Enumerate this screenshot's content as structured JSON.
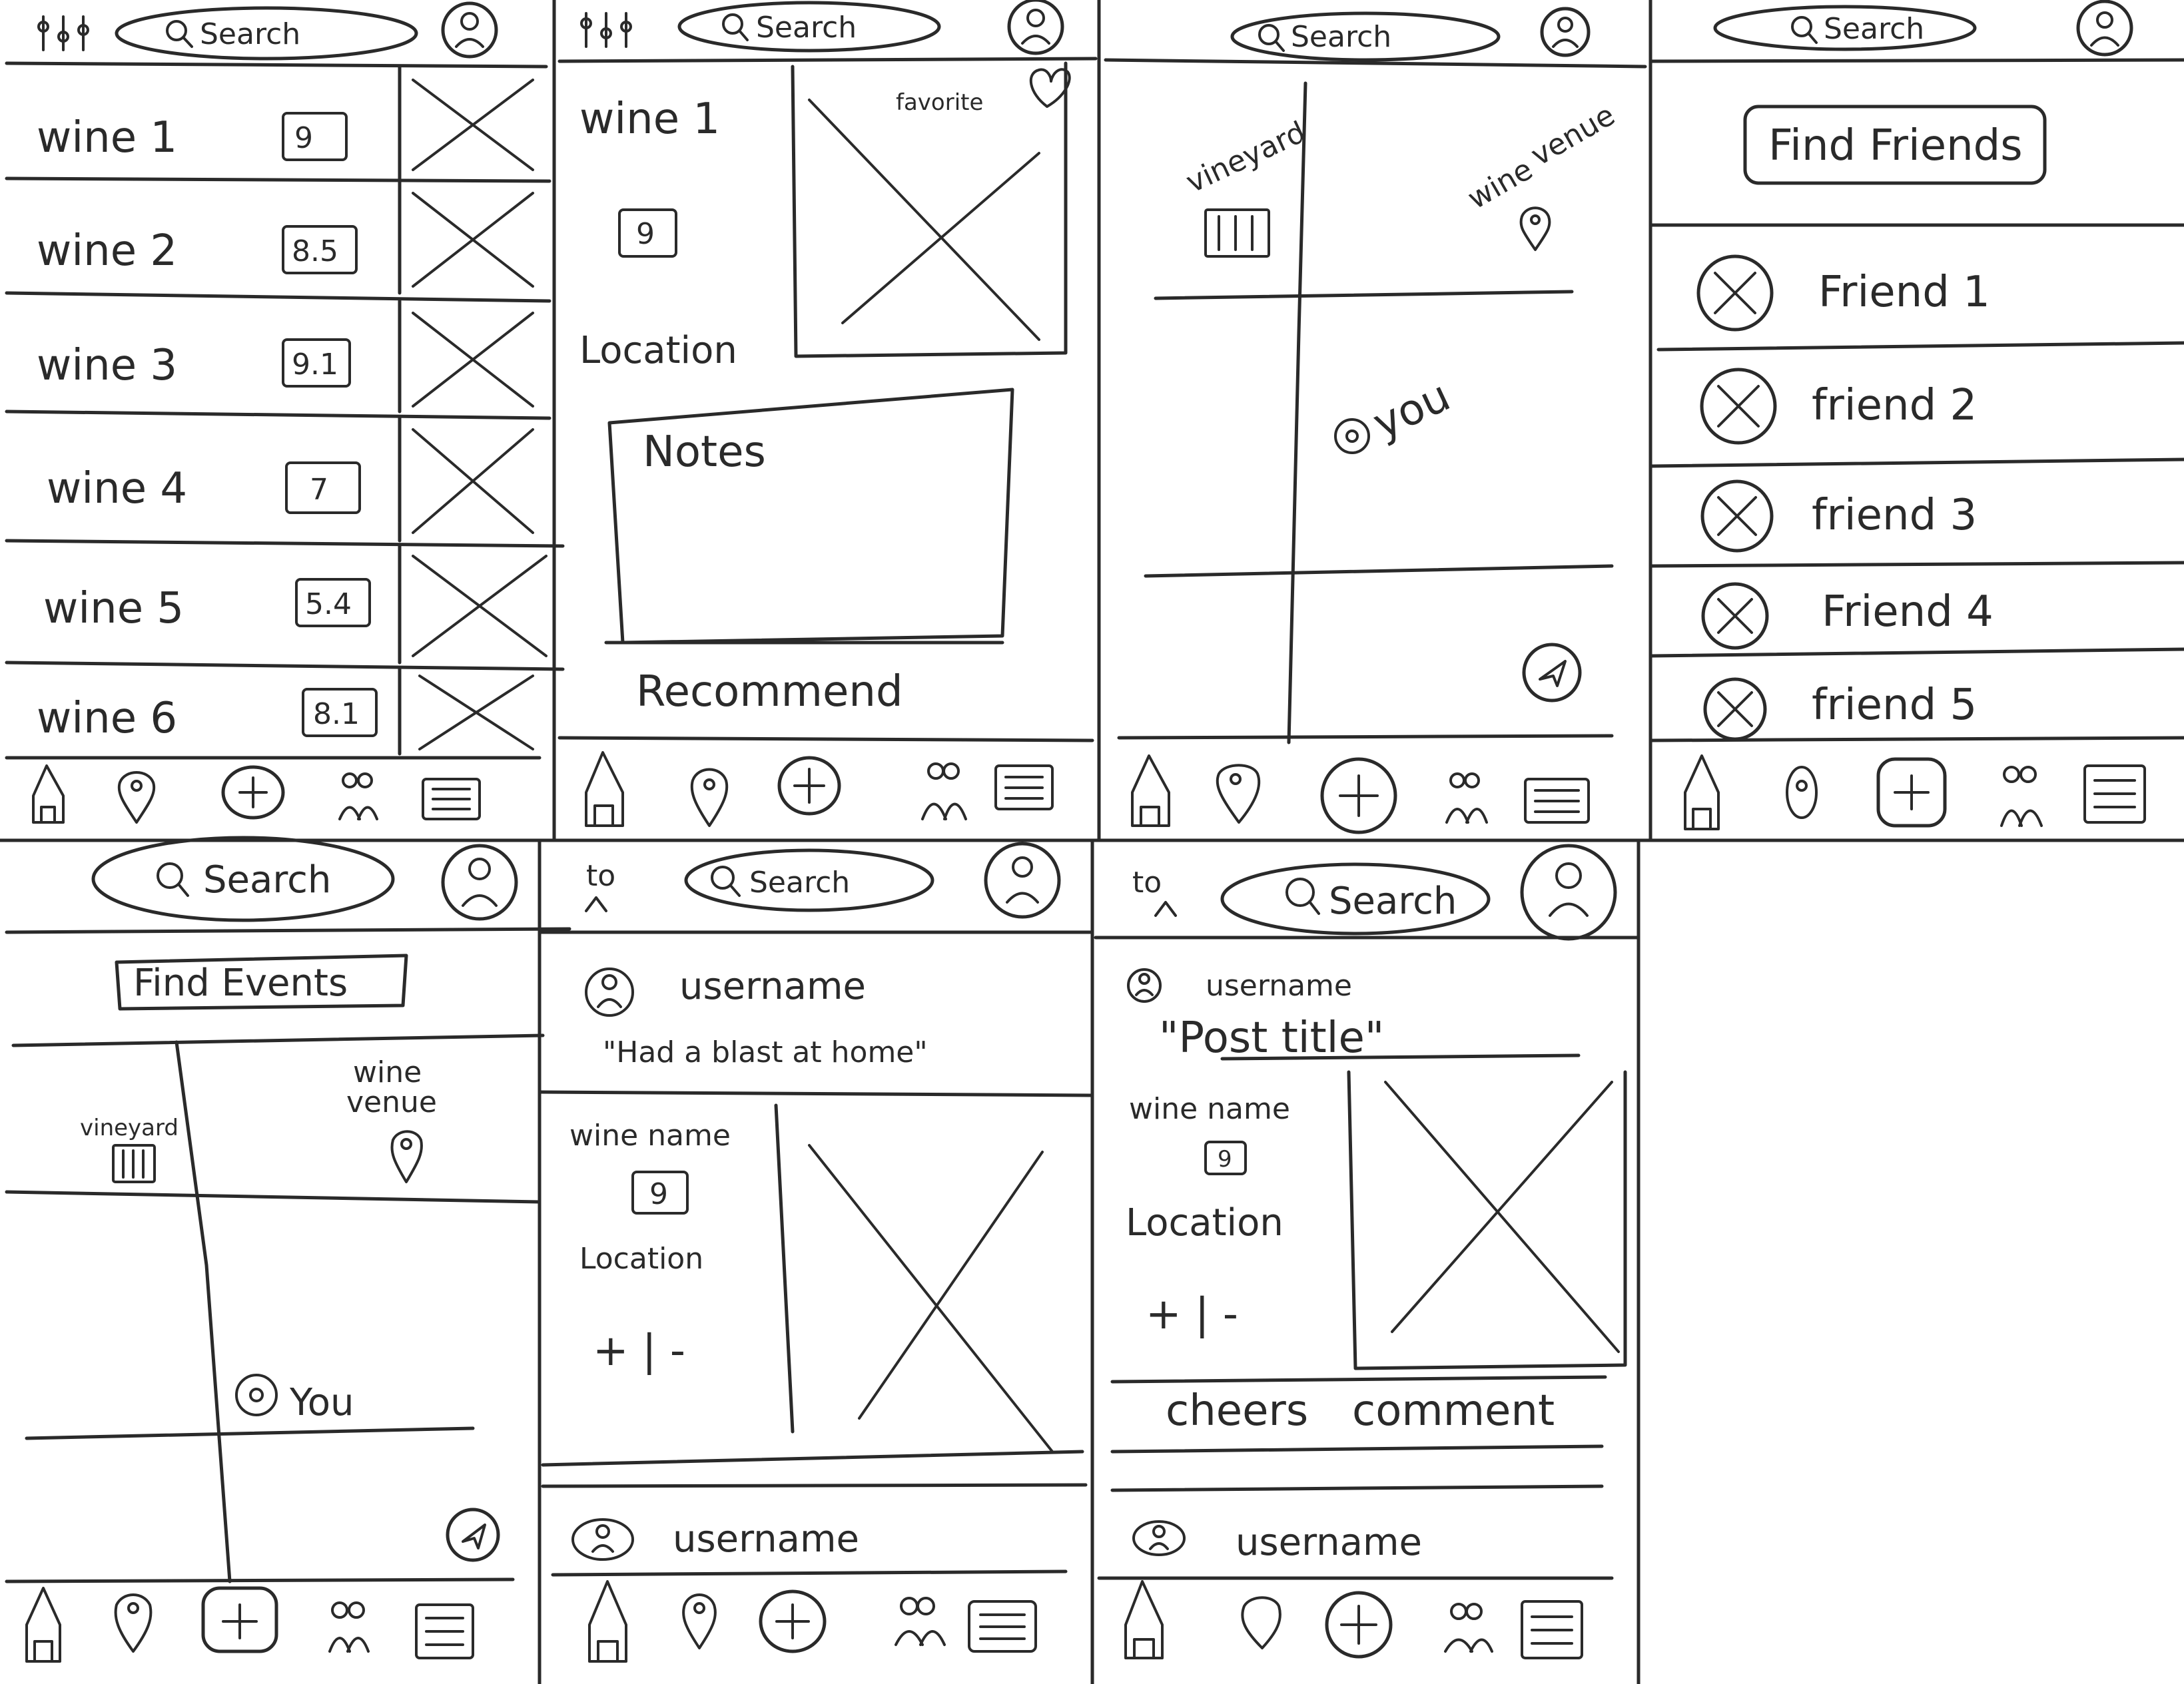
{
  "screens": {
    "wine_list": {
      "search": "Search",
      "wines": [
        {
          "name": "wine 1",
          "score": "9"
        },
        {
          "name": "wine 2",
          "score": "8.5"
        },
        {
          "name": "wine 3",
          "score": "9.1"
        },
        {
          "name": "wine 4",
          "score": "7"
        },
        {
          "name": "wine 5",
          "score": "5.4"
        },
        {
          "name": "wine 6",
          "score": "8.1"
        }
      ]
    },
    "wine_detail": {
      "search": "Search",
      "wine_name": "wine 1",
      "score": "9",
      "location": "Location",
      "favorite": "favorite",
      "notes": "Notes",
      "recommend": "Recommend"
    },
    "map": {
      "search": "Search",
      "vineyard": "vineyard",
      "venue_line1": "wine",
      "venue_line2": "venue",
      "you": "you"
    },
    "friends": {
      "search": "Search",
      "find_button": "Find Friends",
      "friends": [
        "Friend 1",
        "friend 2",
        "friend 3",
        "Friend 4",
        "friend 5"
      ]
    },
    "events": {
      "search": "Search",
      "find_button": "Find Events",
      "vineyard": "vineyard",
      "venue_line1": "wine",
      "venue_line2": "venue",
      "you": "You"
    },
    "feed": {
      "search": "Search",
      "to": "to",
      "username": "username",
      "post_title": "\"Had a blast at home\"",
      "wine_name": "wine name",
      "score": "9",
      "location": "Location",
      "vote": "+ | -",
      "next_username": "username"
    },
    "post": {
      "search": "Search",
      "to": "to",
      "username": "username",
      "post_title": "\"Post title\"",
      "wine_name": "wine name",
      "score": "9",
      "location": "Location",
      "vote": "+ | -",
      "cheers": "cheers",
      "comment": "comment",
      "next_username": "username"
    }
  },
  "icons": {
    "filter": "filter-icon",
    "search": "search-icon",
    "profile": "profile-icon",
    "nav": [
      "home-icon",
      "map-pin-icon",
      "add-icon",
      "friends-icon",
      "list-icon"
    ]
  },
  "colors": {
    "ink": "#2a2a2a",
    "paper": "#ffffff"
  }
}
